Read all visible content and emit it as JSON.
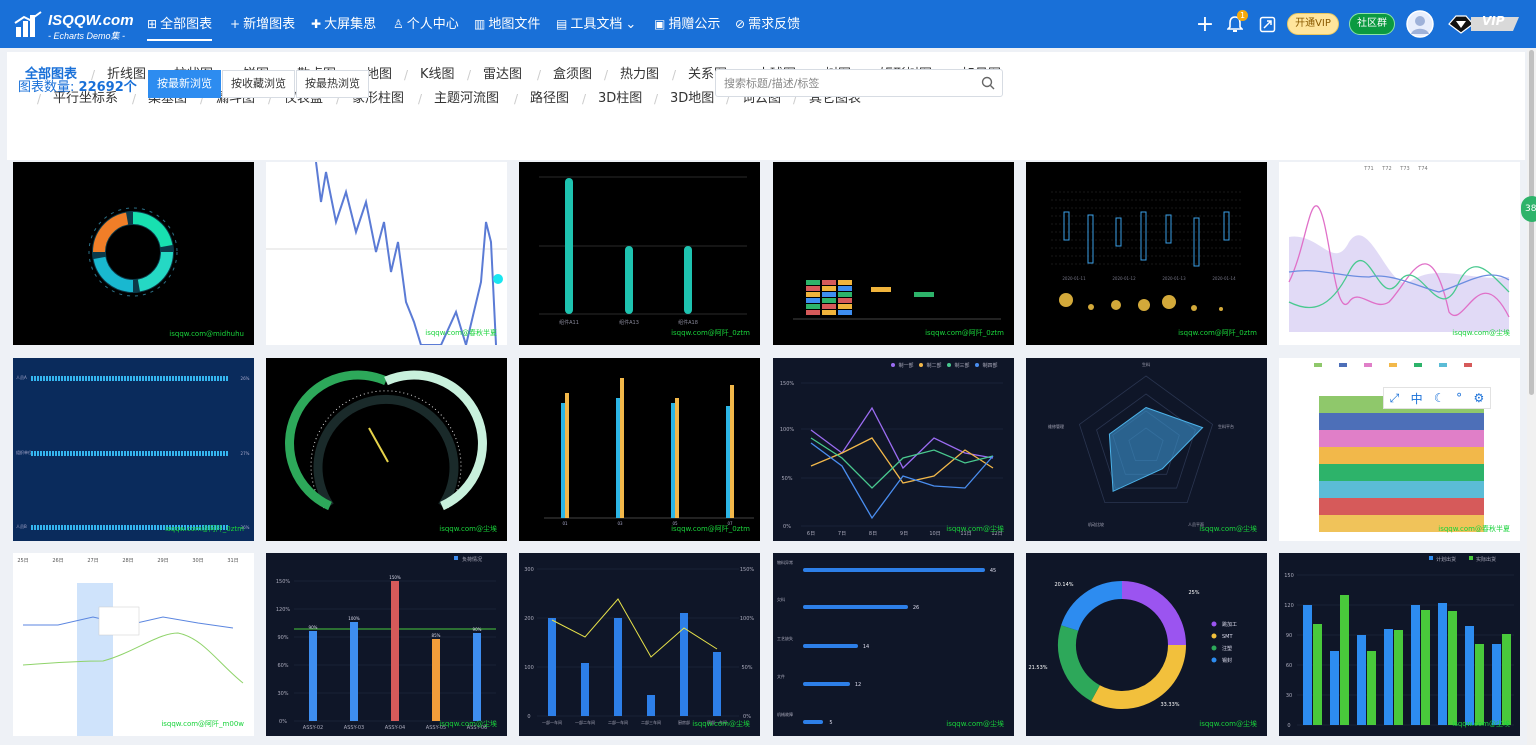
{
  "brand": {
    "name": "ISQQW.com",
    "subtitle": "- Echarts Demo集 -"
  },
  "nav": {
    "items": [
      {
        "label": "全部图表"
      },
      {
        "label": "新增图表"
      },
      {
        "label": "大屏集思"
      },
      {
        "label": "个人中心"
      },
      {
        "label": "地图文件"
      },
      {
        "label": "工具文档"
      },
      {
        "label": "捐赠公示"
      },
      {
        "label": "需求反馈"
      }
    ],
    "notification_count": "1",
    "vip_button": "开通VIP",
    "community_button": "社区群",
    "vip_badge": "VIP"
  },
  "categories": {
    "row1": [
      "全部图表",
      "折线图",
      "柱状图",
      "饼图",
      "散点图",
      "地图",
      "K线图",
      "雷达图",
      "盒须图",
      "热力图",
      "关系图",
      "水球图",
      "树图",
      "矩形树图",
      "旭日图"
    ],
    "row2": [
      "平行坐标系",
      "桑基图",
      "漏斗图",
      "仪表盘",
      "象形柱图",
      "主题河流图",
      "路径图",
      "3D柱图",
      "3D地图",
      "词云图",
      "其它图表"
    ]
  },
  "count": {
    "label": "图表数量:",
    "value": "22692个"
  },
  "sort": {
    "newest": "按最新浏览",
    "favorite": "按收藏浏览",
    "hottest": "按最热浏览"
  },
  "search": {
    "placeholder": "搜索标题/描述/标签"
  },
  "float_badge": "38",
  "toolbar": {
    "lang": "中"
  },
  "cards": [
    {
      "watermark": "isqqw.com@midhuhu"
    },
    {
      "watermark": "isqqw.com@春秋半夏"
    },
    {
      "watermark": "isqqw.com@阿阡_0ztm",
      "labels": [
        "组件A11",
        "组件A13",
        "组件A18"
      ]
    },
    {
      "watermark": "isqqw.com@阿阡_0ztm"
    },
    {
      "watermark": "isqqw.com@阿阡_0ztm",
      "labels": [
        "2020-01-11",
        "2020-01-12",
        "2020-01-13",
        "2020-01-14"
      ]
    },
    {
      "watermark": "isqqw.com@尘埃",
      "legend": [
        "T71",
        "T72",
        "T73",
        "T74"
      ]
    },
    {
      "watermark": "isqqw.com@阿阡_0ztm",
      "labels": [
        "人员A",
        "组织单位",
        "人员B"
      ],
      "values": [
        "26%",
        "27%",
        "36%"
      ]
    },
    {
      "watermark": "isqqw.com@尘埃"
    },
    {
      "watermark": "isqqw.com@阿阡_0ztm",
      "labels": [
        "01",
        "03",
        "05",
        "07"
      ]
    },
    {
      "watermark": "isqqw.com@尘埃",
      "legend": [
        "制一部",
        "制二部",
        "制三部",
        "制四部"
      ],
      "yticks": [
        "150%",
        "100%",
        "50%",
        "0%"
      ],
      "xticks": [
        "6日",
        "7日",
        "8日",
        "9日",
        "10日",
        "11日",
        "12日"
      ]
    },
    {
      "watermark": "isqqw.com@尘埃",
      "labels": [
        "生料",
        "生料平台",
        "人员平面",
        "机动比较",
        "维修管理"
      ],
      "values": [
        "50",
        "80",
        "30",
        "60",
        "46"
      ]
    },
    {
      "watermark": "isqqw.com@春秋半夏"
    },
    {
      "watermark": "isqqw.com@阿阡_m00w",
      "days": [
        "25日",
        "26日",
        "27日",
        "28日",
        "29日",
        "30日",
        "31日"
      ]
    },
    {
      "watermark": "isqqw.com@尘埃",
      "legend": "负荷情况",
      "yticks": [
        "150%",
        "120%",
        "90%",
        "60%",
        "30%",
        "0%"
      ],
      "xticks": [
        "ASSY-02",
        "ASSY-03",
        "ASSY-04",
        "ASSY-05",
        "ASSY-06"
      ],
      "values": [
        "90%",
        "100%",
        "150%",
        "85%",
        "90%"
      ]
    },
    {
      "watermark": "isqqw.com@尘埃",
      "yticks": [
        "300",
        "200",
        "100",
        "0"
      ],
      "ytick2": [
        "150%",
        "100%",
        "50%",
        "0%"
      ],
      "xticks": [
        "一部一车间",
        "一部二车间",
        "二部一车间",
        "二部三车间",
        "厨房部",
        "四部一车间"
      ]
    },
    {
      "watermark": "isqqw.com@尘埃",
      "labels": [
        "物料异常",
        "欠料",
        "工艺缺失",
        "文件",
        "机械故障"
      ],
      "values": [
        "45",
        "26",
        "14",
        "12",
        "5"
      ]
    },
    {
      "watermark": "isqqw.com@尘埃",
      "legend": [
        "跳加工",
        "SMT",
        "注塑",
        "锡封"
      ],
      "values": [
        "25%",
        "33.33%",
        "21.53%",
        "20.14%"
      ]
    },
    {
      "watermark": "isqqw.com@尘埃",
      "legend": [
        "计划出货",
        "实际出货"
      ],
      "yticks": [
        "150",
        "120",
        "90",
        "60",
        "30",
        "0"
      ]
    }
  ],
  "colors": {
    "nav": "#1970d8",
    "primary": "#2d8cf0",
    "watermark": "#19d33b"
  }
}
